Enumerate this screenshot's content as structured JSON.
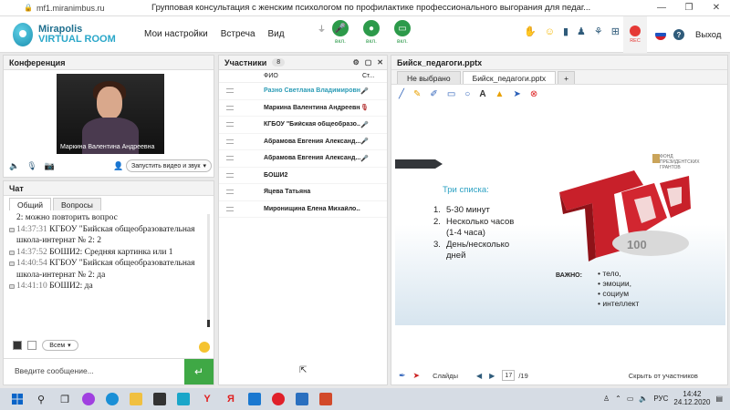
{
  "browser": {
    "url": "mf1.miranimbus.ru",
    "title": "Групповая консультация с женским психологом по профилактике профессионального выгорания для педаг..."
  },
  "header": {
    "logo_line1": "Mirapolis",
    "logo_line2": "VIRTUAL ROOM",
    "menu": [
      "Мои настройки",
      "Встреча",
      "Вид"
    ],
    "controls": [
      {
        "icon": "microphone-icon",
        "label": "вкл."
      },
      {
        "icon": "camera-icon",
        "label": "вкл."
      },
      {
        "icon": "screen-share-icon",
        "label": "вкл."
      }
    ],
    "rec_label": "REC",
    "exit_label": "Выход"
  },
  "conference": {
    "title": "Конференция",
    "video_name": "Маркина Валентина Андреевна",
    "video_button": "Запустить видео и звук"
  },
  "chat": {
    "title": "Чат",
    "tabs": [
      "Общий",
      "Вопросы"
    ],
    "messages": [
      {
        "time": "",
        "text": "2: можно повторить вопрос",
        "icon": false
      },
      {
        "time": "14:37:31",
        "text": "КГБОУ \"Бийская общеобразовательная школа-интернат № 2: 2",
        "icon": true
      },
      {
        "time": "14:37:52",
        "text": "БОШИ2: Средняя картинка или 1",
        "icon": true
      },
      {
        "time": "14:40:54",
        "text": "КГБОУ \"Бийская общеобразовательная школа-интернат № 2: да",
        "icon": true
      },
      {
        "time": "14:41:10",
        "text": "БОШИ2: да",
        "icon": true
      }
    ],
    "recipient": "Всем",
    "placeholder": "Введите сообщение..."
  },
  "participants": {
    "title": "Участники",
    "count": "8",
    "col_name": "ФИО",
    "col_status": "Ст...",
    "list": [
      {
        "name": "Разно Светлана Владимировна",
        "highlight": true
      },
      {
        "name": "Маркина Валентина Андреевна",
        "highlight": false
      },
      {
        "name": "КГБОУ \"Бийская общеобразо...",
        "highlight": false
      },
      {
        "name": "Абрамова Евгения Александ...",
        "highlight": false
      },
      {
        "name": "Абрамова Евгения Александ...",
        "highlight": false
      },
      {
        "name": "БОШИ2",
        "highlight": false
      },
      {
        "name": "Яцева Татьяна",
        "highlight": false
      },
      {
        "name": "Миронищина Елена Михайло...",
        "highlight": false
      }
    ]
  },
  "presentation": {
    "title": "Бийск_педагоги.pptx",
    "tabs": [
      "Не выбрано",
      "Бийск_педагоги.pptx",
      "+"
    ],
    "slide": {
      "fund": "ФОНД ПРЕЗИДЕНТСКИХ ГРАНТОВ",
      "heading": "Три списка:",
      "list": [
        {
          "n": "1.",
          "text": "5-30 минут"
        },
        {
          "n": "2.",
          "text": "Несколько часов (1-4 часа)"
        },
        {
          "n": "3.",
          "text": "День/несколько дней"
        }
      ],
      "important": "ВАЖНО:",
      "bullets": [
        "тело,",
        "эмоции,",
        "социум",
        "интеллект"
      ],
      "top_text": "ТОП",
      "top_num": "100"
    },
    "footer": {
      "slides_label": "Слайды",
      "page": "17",
      "total": "/19",
      "hide_label": "Скрыть от участников"
    }
  },
  "taskbar": {
    "lang": "РУС",
    "time": "14:42",
    "date": "24.12.2020"
  }
}
